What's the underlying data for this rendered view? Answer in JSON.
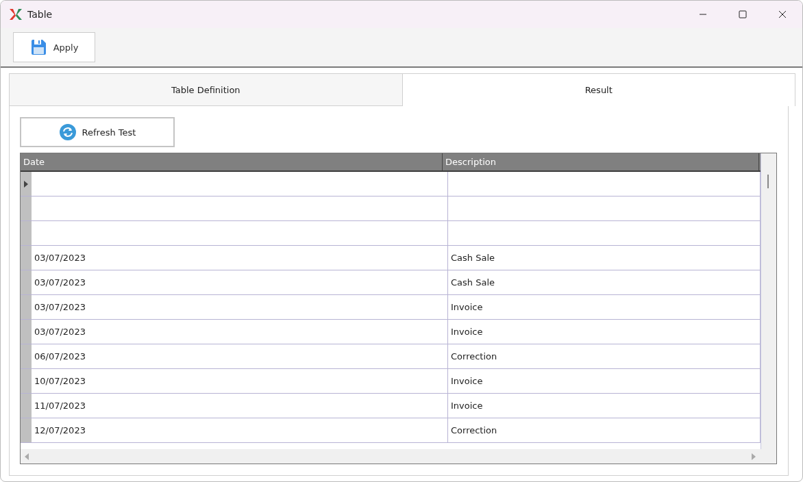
{
  "window": {
    "title": "Table"
  },
  "toolbar": {
    "buttons": [
      {
        "label": "Apply"
      }
    ]
  },
  "tabs": [
    {
      "label": "Table Definition",
      "selected": false
    },
    {
      "label": "Result",
      "selected": true
    }
  ],
  "refresh_button": {
    "label": "Refresh Test"
  },
  "table": {
    "columns": [
      "Date",
      "Description"
    ],
    "rows": [
      {
        "date": "",
        "description": "",
        "current": true
      },
      {
        "date": "",
        "description": "",
        "current": false
      },
      {
        "date": "",
        "description": "",
        "current": false
      },
      {
        "date": "03/07/2023",
        "description": "Cash Sale",
        "current": false
      },
      {
        "date": "03/07/2023",
        "description": "Cash Sale",
        "current": false
      },
      {
        "date": "03/07/2023",
        "description": "Invoice",
        "current": false
      },
      {
        "date": "03/07/2023",
        "description": "Invoice",
        "current": false
      },
      {
        "date": "06/07/2023",
        "description": "Correction",
        "current": false
      },
      {
        "date": "10/07/2023",
        "description": "Invoice",
        "current": false
      },
      {
        "date": "11/07/2023",
        "description": "Invoice",
        "current": false
      },
      {
        "date": "12/07/2023",
        "description": "Correction",
        "current": false
      }
    ]
  }
}
